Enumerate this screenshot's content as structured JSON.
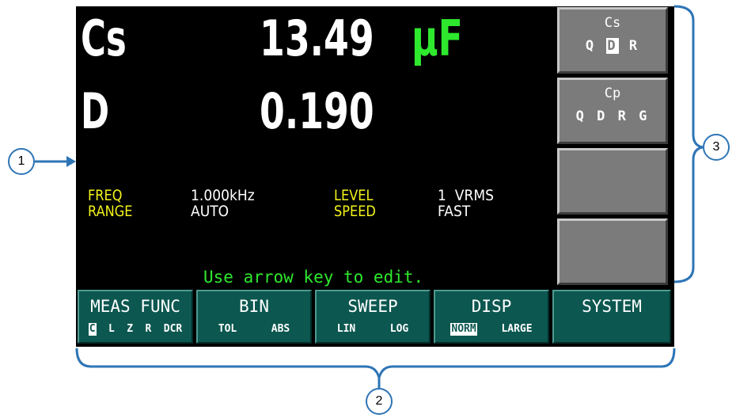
{
  "primary": {
    "param": "Cs",
    "value": "13.49",
    "unit": "µF"
  },
  "secondary": {
    "param": "D",
    "value": "0.190"
  },
  "settings": {
    "freq_label": "FREQ",
    "freq_value": "1.000kHz",
    "range_label": "RANGE",
    "range_value": "AUTO",
    "level_label": "LEVEL",
    "level_value": "1  VRMS",
    "speed_label": "SPEED",
    "speed_value": "FAST"
  },
  "hint": "Use arrow key to edit.",
  "side_buttons": [
    {
      "title": "Cs",
      "options": [
        "Q",
        "D",
        "R"
      ],
      "selected": "D"
    },
    {
      "title": "Cp",
      "options": [
        "Q",
        "D",
        "R",
        "G"
      ]
    },
    {
      "title": ""
    },
    {
      "title": ""
    }
  ],
  "soft_keys": [
    {
      "label": "MEAS FUNC",
      "options": [
        "C",
        "L",
        "Z",
        "R",
        "DCR"
      ],
      "selected": "C"
    },
    {
      "label": "BIN",
      "options": [
        "TOL",
        "ABS"
      ]
    },
    {
      "label": "SWEEP",
      "options": [
        "LIN",
        "LOG"
      ]
    },
    {
      "label": "DISP",
      "options": [
        "NORM",
        "LARGE"
      ],
      "selected": "NORM"
    },
    {
      "label": "SYSTEM",
      "options": []
    }
  ],
  "callouts": [
    "1",
    "2",
    "3"
  ],
  "colors": {
    "screen_bg": "#000000",
    "highlight_green": "#2ee82e",
    "label_yellow": "#f3f31a",
    "softkey_teal": "#0c5750",
    "side_button_gray": "#7b7b7b",
    "callout_blue": "#2e75b6"
  }
}
